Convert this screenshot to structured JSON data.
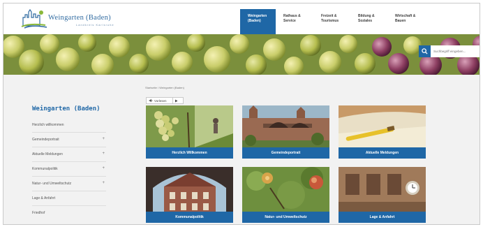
{
  "site": {
    "logo_title": "Weingarten (Baden)",
    "logo_subtitle": "Landkreis Karlsruhe"
  },
  "nav": [
    {
      "label": "Weingarten\n(Baden)",
      "active": true
    },
    {
      "label": "Rathaus &\nService",
      "active": false
    },
    {
      "label": "Freizeit &\nTourismus",
      "active": false
    },
    {
      "label": "Bildung &\nSoziales",
      "active": false
    },
    {
      "label": "Wirtschaft &\nBauen",
      "active": false
    }
  ],
  "search": {
    "placeholder": "Suchbegriff eingeben..."
  },
  "breadcrumb": "Startseite / Weingarten (Baden)",
  "read_button": {
    "label": "Vorlesen",
    "icon": "speaker-icon",
    "play_icon": "play-icon"
  },
  "sidebar": {
    "title": "Weingarten (Baden)",
    "items": [
      {
        "label": "Herzlich willkommen",
        "expandable": false
      },
      {
        "label": "Gemeindeportrait",
        "expandable": true
      },
      {
        "label": "Aktuelle Meldungen",
        "expandable": true
      },
      {
        "label": "Kommunalpolitik",
        "expandable": true
      },
      {
        "label": "Natur- und Umweltschutz",
        "expandable": true
      },
      {
        "label": "Lage & Anfahrt",
        "expandable": false
      },
      {
        "label": "Friedhof",
        "expandable": false
      }
    ]
  },
  "tiles": [
    {
      "label": "Herzlich Willkommen"
    },
    {
      "label": "Gemeindeportrait"
    },
    {
      "label": "Aktuelle Meldungen"
    },
    {
      "label": "Kommunalpolitik"
    },
    {
      "label": "Natur- und Umweltschutz"
    },
    {
      "label": "Lage & Anfahrt"
    }
  ],
  "colors": {
    "primary": "#1f67a6",
    "background": "#f2f2f2"
  }
}
